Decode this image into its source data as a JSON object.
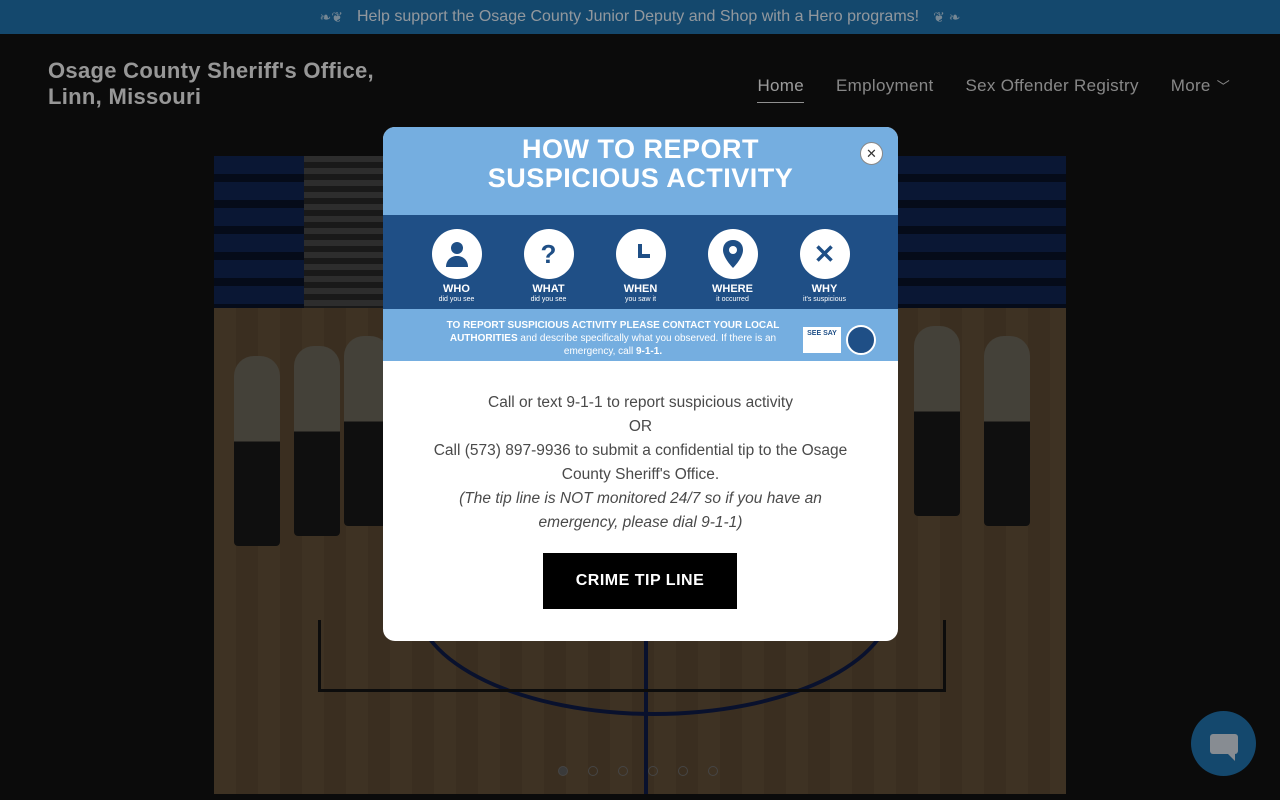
{
  "banner": {
    "text": "Help support the Osage County Junior Deputy and Shop with a Hero programs!"
  },
  "header": {
    "site_title_line1": "Osage County Sheriff's Office,",
    "site_title_line2": "Linn, Missouri"
  },
  "nav": {
    "items": [
      {
        "label": "Home",
        "active": true
      },
      {
        "label": "Employment",
        "active": false
      },
      {
        "label": "Sex Offender Registry",
        "active": false
      },
      {
        "label": "More",
        "active": false
      }
    ]
  },
  "carousel": {
    "dot_count": 6,
    "active_index": 0
  },
  "modal": {
    "poster": {
      "title_line1": "HOW TO REPORT",
      "title_line2": "SUSPICIOUS ACTIVITY",
      "steps": [
        {
          "icon": "person-icon",
          "label": "WHO",
          "sub": "did you see"
        },
        {
          "icon": "question-icon",
          "label": "WHAT",
          "sub": "did you see"
        },
        {
          "icon": "clock-icon",
          "label": "WHEN",
          "sub": "you saw it"
        },
        {
          "icon": "pin-icon",
          "label": "WHERE",
          "sub": "it occurred"
        },
        {
          "icon": "x-icon",
          "label": "WHY",
          "sub": "it's suspicious"
        }
      ],
      "footer_bold": "TO REPORT SUSPICIOUS ACTIVITY PLEASE CONTACT YOUR LOCAL AUTHORITIES",
      "footer_text": "and describe specifically what you observed. If there is an emergency, call",
      "footer_number": "9-1-1.",
      "seesay_label": "SEE SAY"
    },
    "line1": "Call or text 9-1-1 to report suspicious activity",
    "line2": "OR",
    "line3": "Call (573) 897-9936 to submit a confidential tip to the Osage County Sheriff's Office.",
    "note": "(The tip line is NOT monitored 24/7 so if you have an emergency, please dial 9-1-1)",
    "button_label": "CRIME TIP LINE",
    "close_label": "✕"
  },
  "colors": {
    "banner_bg": "#1f6fa8",
    "poster_blue": "#75aee0",
    "poster_navy": "#1f4f86"
  }
}
